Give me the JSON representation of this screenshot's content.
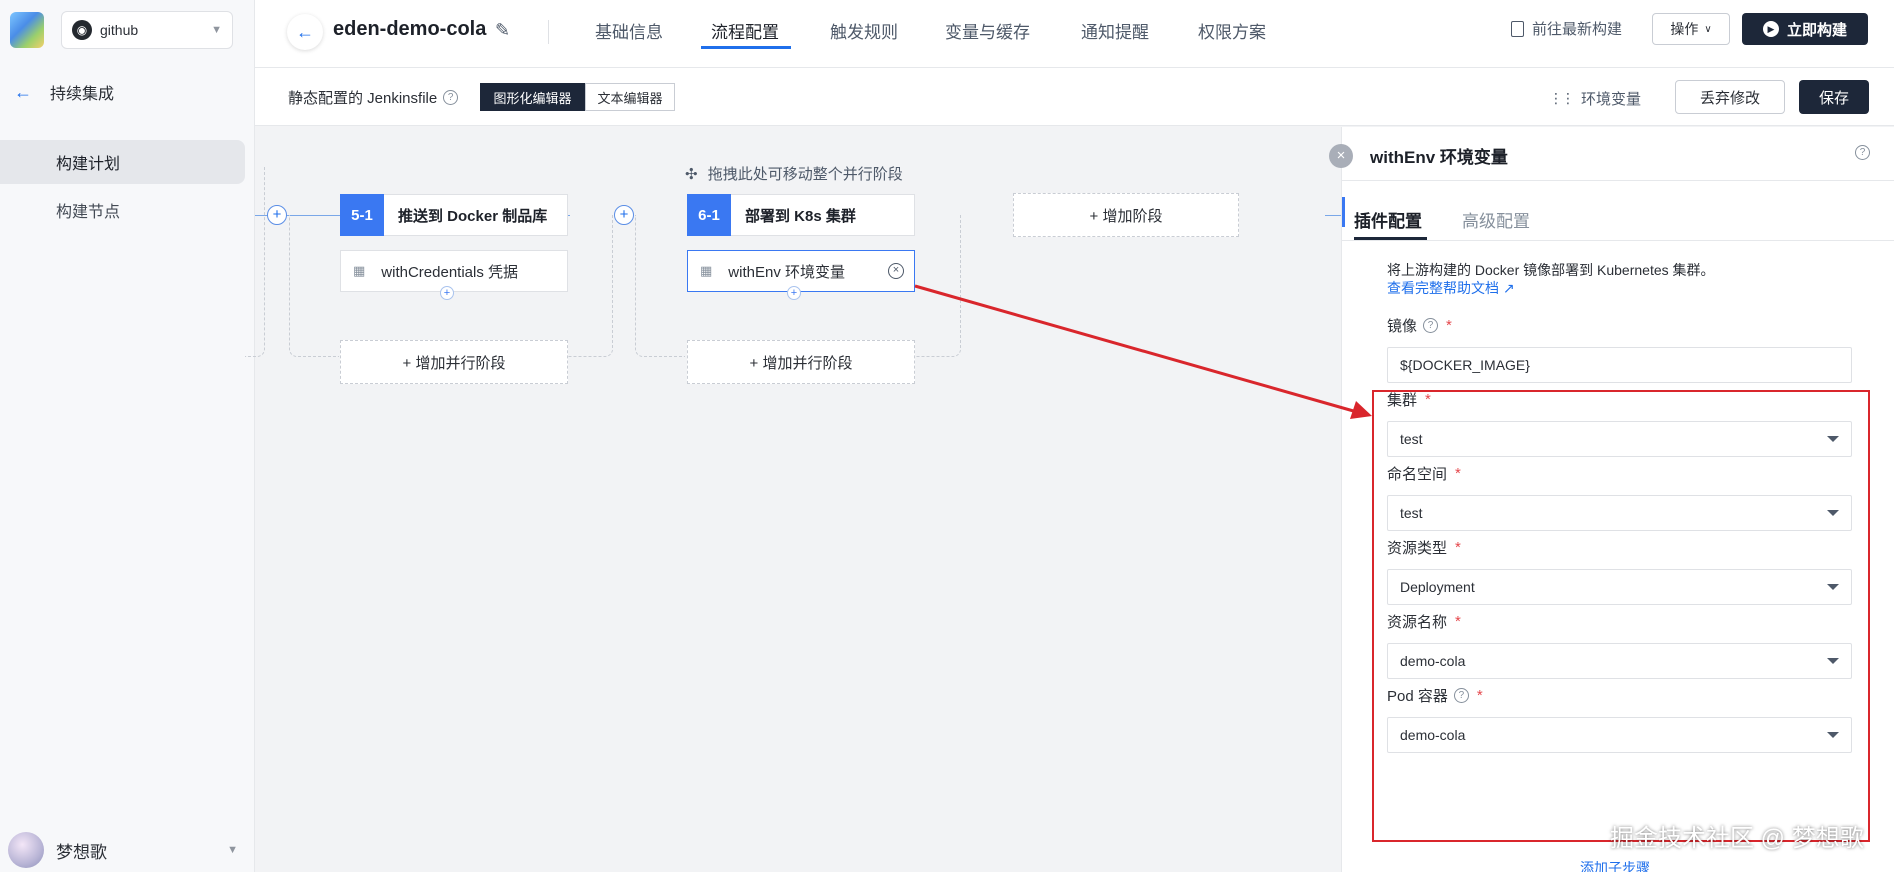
{
  "sidebar": {
    "repo": "github",
    "back_label": "持续集成",
    "items": [
      {
        "label": "构建计划"
      },
      {
        "label": "构建节点"
      }
    ],
    "user": "梦想歌"
  },
  "header": {
    "title": "eden-demo-cola",
    "tabs": [
      {
        "label": "基础信息"
      },
      {
        "label": "流程配置"
      },
      {
        "label": "触发规则"
      },
      {
        "label": "变量与缓存"
      },
      {
        "label": "通知提醒"
      },
      {
        "label": "权限方案"
      }
    ],
    "goto_latest": "前往最新构建",
    "ops": "操作",
    "build": "立即构建"
  },
  "subbar": {
    "static_label": "静态配置的 Jenkinsfile",
    "graph_editor": "图形化编辑器",
    "text_editor": "文本编辑器",
    "env_vars": "环境变量",
    "discard": "丢弃修改",
    "save": "保存"
  },
  "canvas": {
    "drag_hint": "拖拽此处可移动整个并行阶段",
    "stages": [
      {
        "num": "5-1",
        "name": "推送到 Docker 制品库",
        "step": "withCredentials 凭据",
        "add_parallel": "+ 增加并行阶段"
      },
      {
        "num": "6-1",
        "name": "部署到 K8s 集群",
        "step": "withEnv 环境变量",
        "add_parallel": "+ 增加并行阶段"
      }
    ],
    "add_stage": "+ 增加阶段"
  },
  "panel": {
    "title": "withEnv 环境变量",
    "tabs": [
      "插件配置",
      "高级配置"
    ],
    "description": "将上游构建的 Docker 镜像部署到 Kubernetes 集群。",
    "help_link": "查看完整帮助文档",
    "fields": [
      {
        "label": "镜像",
        "value": "${DOCKER_IMAGE}"
      },
      {
        "label": "集群",
        "value": "test"
      },
      {
        "label": "命名空间",
        "value": "test"
      },
      {
        "label": "资源类型",
        "value": "Deployment"
      },
      {
        "label": "资源名称",
        "value": "demo-cola"
      },
      {
        "label": "Pod 容器",
        "value": "demo-cola"
      }
    ],
    "more_link": "添加子步骤"
  },
  "watermark": "掘金技术社区 @ 梦想歌",
  "colors": {
    "accent": "#3a78f2",
    "dark": "#1d2739",
    "annotation": "#d9262c"
  }
}
